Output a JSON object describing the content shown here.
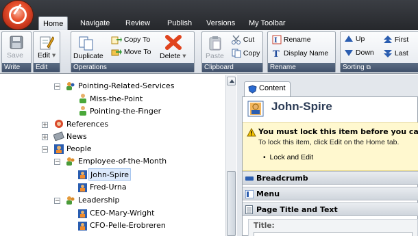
{
  "tabs": [
    "Home",
    "Navigate",
    "Review",
    "Publish",
    "Versions",
    "My Toolbar"
  ],
  "ribbon": {
    "write": {
      "label": "Write",
      "save": "Save"
    },
    "edit": {
      "label": "Edit",
      "edit": "Edit"
    },
    "operations": {
      "label": "Operations",
      "duplicate": "Duplicate",
      "copy_to": "Copy To",
      "move_to": "Move To",
      "delete": "Delete"
    },
    "clipboard": {
      "label": "Clipboard",
      "paste": "Paste",
      "cut": "Cut",
      "copy": "Copy"
    },
    "rename": {
      "label": "Rename",
      "rename": "Rename",
      "display_name": "Display Name"
    },
    "sorting": {
      "label": "Sorting",
      "up": "Up",
      "first": "First",
      "down": "Down",
      "last": "Last"
    }
  },
  "tree": {
    "items": [
      {
        "label": "Pointing-Related-Services",
        "expander": "−"
      },
      {
        "label": "Miss-the-Point"
      },
      {
        "label": "Pointing-the-Finger"
      },
      {
        "label": "References",
        "expander": "+"
      },
      {
        "label": "News",
        "expander": "+"
      },
      {
        "label": "People",
        "expander": "−"
      },
      {
        "label": "Employee-of-the-Month",
        "expander": "−"
      },
      {
        "label": "John-Spire"
      },
      {
        "label": "Fred-Urna"
      },
      {
        "label": "Leadership",
        "expander": "−"
      },
      {
        "label": "CEO-Mary-Wright"
      },
      {
        "label": "CFO-Pelle-Erobreren"
      }
    ]
  },
  "content": {
    "tab": "Content",
    "title": "John-Spire",
    "warning_title": "You must lock this item before you can e",
    "warning_text": "To lock this item, click Edit on the Home tab.",
    "warning_bullet": "Lock and Edit",
    "sections": [
      "Breadcrumb",
      "Menu",
      "Page Title and Text"
    ],
    "field_label": "Title:"
  },
  "colors": {
    "accent": "#3f5a86",
    "warning": "#fff6c6",
    "selection": "#dbe9fb"
  }
}
